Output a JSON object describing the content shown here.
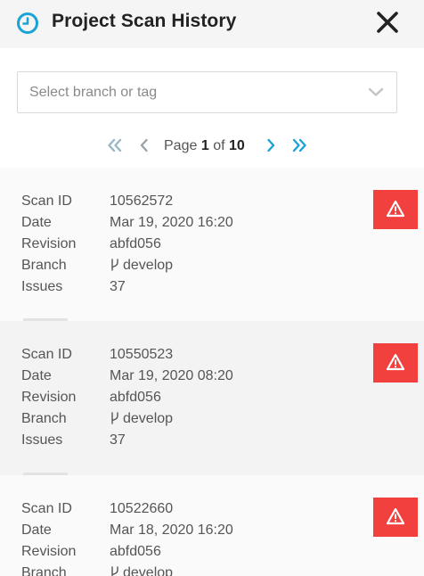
{
  "header": {
    "title": "Project Scan History",
    "accent_color": "#1ba3d6",
    "icons": {
      "clock": "clock-icon",
      "close": "close-icon"
    }
  },
  "branch_select": {
    "placeholder": "Select branch or tag",
    "icon": "chevron-down-icon"
  },
  "pagination": {
    "page_word": "Page",
    "current_page": "1",
    "of_word": "of",
    "total_pages": "10",
    "icons": [
      "first-page-icon",
      "prev-page-icon",
      "next-page-icon",
      "last-page-icon"
    ]
  },
  "labels": {
    "scan_id": "Scan ID",
    "date": "Date",
    "revision": "Revision",
    "branch": "Branch",
    "issues": "Issues"
  },
  "scans": [
    {
      "scan_id": "10562572",
      "date": "Mar 19, 2020 16:20",
      "revision": "abfd056",
      "branch": "develop",
      "issues": "37",
      "status": "warning"
    },
    {
      "scan_id": "10550523",
      "date": "Mar 19, 2020 08:20",
      "revision": "abfd056",
      "branch": "develop",
      "issues": "37",
      "status": "warning"
    },
    {
      "scan_id": "10522660",
      "date": "Mar 18, 2020 16:20",
      "revision": "abfd056",
      "branch": "develop",
      "issues": "",
      "status": "warning"
    }
  ],
  "colors": {
    "warning": "#f2403f",
    "alt_row": "#f5f5f5",
    "row": "#fafafa"
  }
}
